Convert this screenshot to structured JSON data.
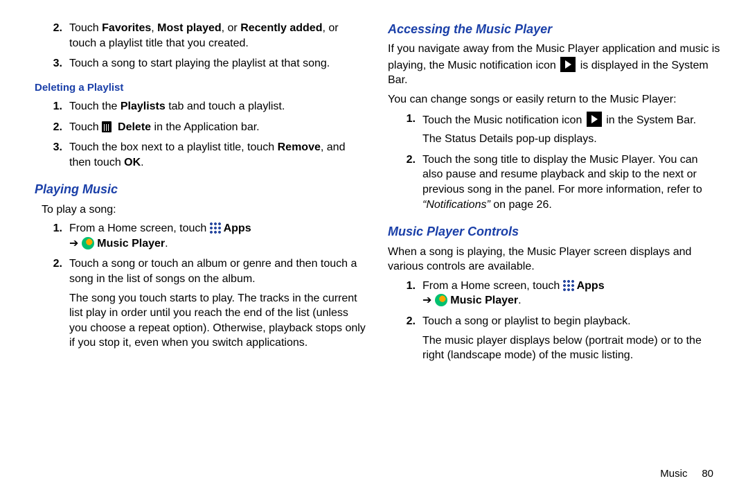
{
  "left": {
    "topItems": [
      {
        "num": "2.",
        "html": "Touch <b>Favorites</b>, <b>Most played</b>, or <b>Recently added</b>, or touch a playlist title that you created."
      },
      {
        "num": "3.",
        "text": "Touch a song to start playing the playlist at that song."
      }
    ],
    "deleteHead": "Deleting a Playlist",
    "delItems": [
      {
        "num": "1.",
        "html": "Touch the <b>Playlists</b> tab and touch a playlist."
      },
      {
        "num": "2.",
        "pre": "Touch ",
        "iconTrash": true,
        "post": " <b>Delete</b> in the Application bar."
      },
      {
        "num": "3.",
        "html": "Touch the box next to a playlist title, touch <b>Remove</b>, and then touch <b>OK</b>."
      }
    ],
    "playingHead": "Playing Music",
    "playingIntro": "To play a song:",
    "playItems": [
      {
        "num": "1.",
        "line1_pre": "From a Home screen, touch ",
        "line1_apps": " Apps",
        "line2_arrow": "➔ ",
        "line2_music": " Music Player",
        "line2_end": "."
      },
      {
        "num": "2.",
        "text": "Touch a song or touch an album or genre and then touch a song in the list of songs on the album.",
        "cont": "The song you touch starts to play. The tracks in the current list play in order until you reach the end of the list (unless you choose a repeat option). Otherwise, playback stops only if you stop it, even when you switch applications."
      }
    ]
  },
  "right": {
    "accessHead": "Accessing the Music Player",
    "accessP1_pre": "If you navigate away from the Music Player application and music is playing, the Music notification icon ",
    "accessP1_post": " is displayed in the System Bar.",
    "accessP2": "You can change songs or easily return to the Music Player:",
    "accessItems": [
      {
        "num": "1.",
        "pre": "Touch the Music notification icon ",
        "post": " in the System Bar.",
        "cont": "The Status Details pop-up displays."
      },
      {
        "num": "2.",
        "html": "Touch the song title to display the Music Player. You can also pause and resume playback and skip to the next or previous song in the panel. For more information, refer to <i>\"Notifications\"</i> on page 26."
      }
    ],
    "controlsHead": "Music Player Controls",
    "controlsIntro": "When a song is playing, the Music Player screen displays and various controls are available.",
    "controlItems": [
      {
        "num": "1.",
        "line1_pre": "From a Home screen, touch ",
        "line1_apps": " Apps",
        "line2_arrow": "➔ ",
        "line2_music": " Music Player",
        "line2_end": "."
      },
      {
        "num": "2.",
        "text": "Touch a song or playlist to begin playback.",
        "cont": "The music player displays below (portrait mode) or to the right (landscape mode) of the music listing."
      }
    ]
  },
  "footer": {
    "section": "Music",
    "page": "80"
  }
}
